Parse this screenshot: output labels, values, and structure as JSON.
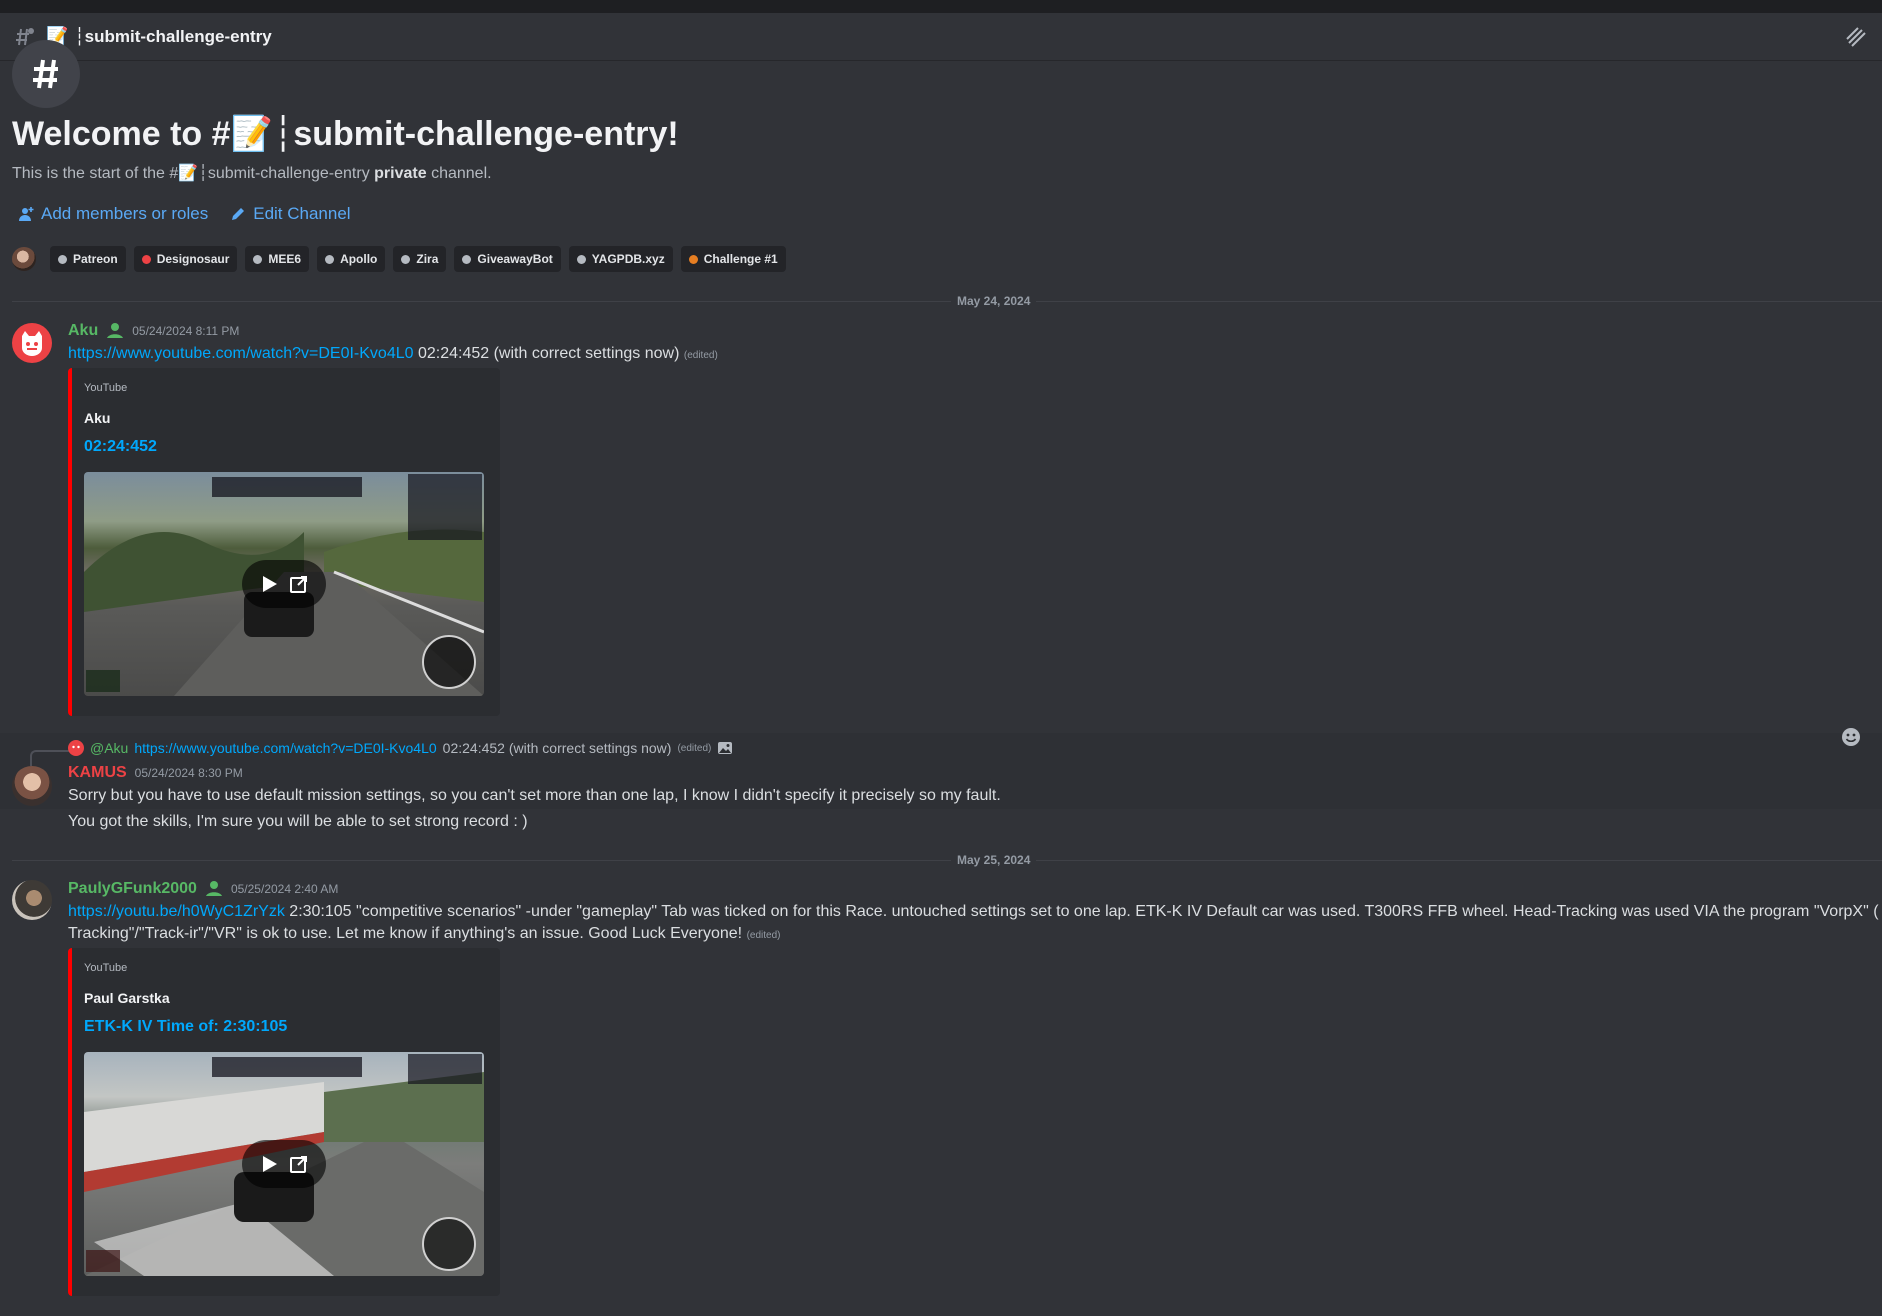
{
  "header": {
    "channel_emoji": "📝",
    "channel_name": "┆submit-challenge-entry"
  },
  "welcome": {
    "title_prefix": "Welcome to #",
    "title_emoji": "📝",
    "title_suffix": "┆submit-challenge-entry!",
    "sub_start": "This is the start of the #",
    "sub_emoji": "📝",
    "sub_channel": "┆submit-challenge-entry",
    "sub_private": "private",
    "sub_end": "channel.",
    "add_members": "Add members or roles",
    "edit_channel": "Edit Channel"
  },
  "roles": [
    {
      "name": "Patreon",
      "color": "#b5bac1"
    },
    {
      "name": "Designosaur",
      "color": "#ed4245"
    },
    {
      "name": "MEE6",
      "color": "#b5bac1"
    },
    {
      "name": "Apollo",
      "color": "#b5bac1"
    },
    {
      "name": "Zira",
      "color": "#b5bac1"
    },
    {
      "name": "GiveawayBot",
      "color": "#b5bac1"
    },
    {
      "name": "YAGPDB.xyz",
      "color": "#b5bac1"
    },
    {
      "name": "Challenge #1",
      "color": "#e67e22"
    }
  ],
  "dates": {
    "d1": "May 24, 2024",
    "d2": "May 25, 2024"
  },
  "msg1": {
    "author": "Aku",
    "author_color": "#57b865",
    "timestamp": "05/24/2024 8:11 PM",
    "link": "https://www.youtube.com/watch?v=DE0I-Kvo4L0",
    "text": " 02:24:452 (with correct settings now)",
    "edited": "(edited)",
    "embed": {
      "provider": "YouTube",
      "author": "Aku",
      "title": "02:24:452"
    }
  },
  "msg2": {
    "reply_to": "@Aku",
    "reply_link": "https://www.youtube.com/watch?v=DE0I-Kvo4L0",
    "reply_text": "02:24:452 (with correct settings now)",
    "reply_edited": "(edited)",
    "author": "KAMUS",
    "author_color": "#ed4245",
    "timestamp": "05/24/2024 8:30 PM",
    "line1": "Sorry but you have to use default mission settings, so you can't set more than one lap, I know I didn't specify it precisely so my fault.",
    "line2": "You got the skills, I'm sure you will be able to set strong record : )"
  },
  "msg3": {
    "author": "PaulyGFunk2000",
    "author_color": "#57b865",
    "timestamp": "05/25/2024 2:40 AM",
    "link": "https://youtu.be/h0WyC1ZrYzk",
    "text_line1": " 2:30:105  \"competitive scenarios\" -under \"gameplay\" Tab was ticked on for this Race. untouched settings set to one lap. ETK-K IV Default car was used. T300RS FFB wheel. Head-Tracking was used VIA the program \"VorpX\" ( I hope \"Head-",
    "text_line2": "Tracking\"/\"Track-ir\"/\"VR\" is ok to use. Let me know if anything's an issue. Good Luck Everyone!",
    "edited": "(edited)",
    "embed": {
      "provider": "YouTube",
      "author": "Paul Garstka",
      "title": "ETK-K IV Time of: 2:30:105"
    }
  },
  "icons": {
    "header": "threads-hash-icon",
    "threads": "threads-icon",
    "welcome": "hash-large-icon",
    "add": "add-member-icon",
    "edit": "pencil-icon",
    "badge": "server-boost-badge-icon",
    "play": "play-icon",
    "open": "open-external-icon",
    "image": "image-icon",
    "reaction": "add-reaction-icon"
  }
}
